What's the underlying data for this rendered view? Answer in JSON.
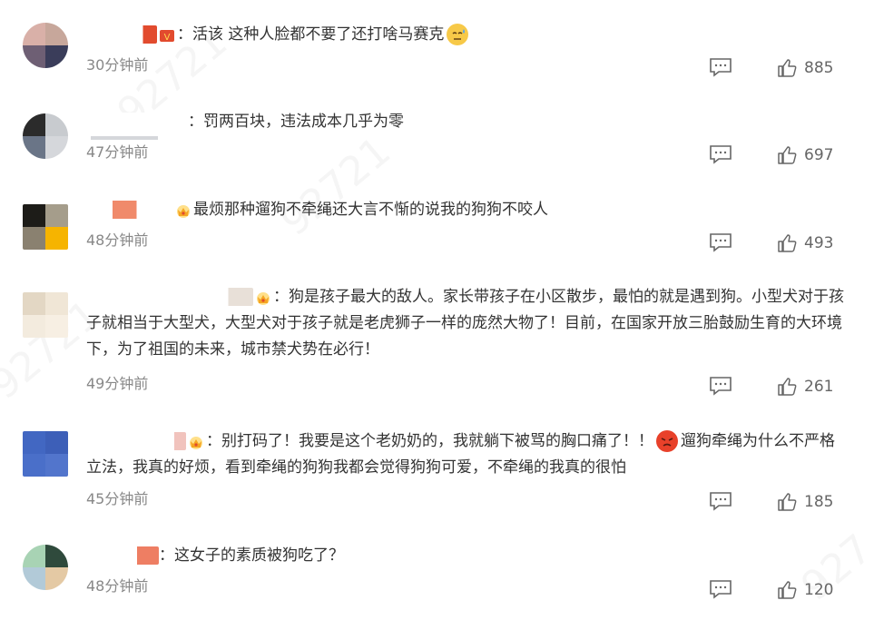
{
  "comments": [
    {
      "text": "：活该 这种人脸都不要了还打啥马赛克",
      "time": "30分钟前",
      "likes": "885",
      "avatar": [
        "#d9b0a8",
        "#c7a79b",
        "#6e5f74",
        "#3a3d5a"
      ],
      "name_color": "#e24b2e",
      "emoji": "😓"
    },
    {
      "text": "：罚两百块，违法成本几乎为零",
      "time": "47分钟前",
      "likes": "697",
      "avatar": [
        "#2b2b2b",
        "#c8cbcf",
        "#6a7587",
        "#d5d7db"
      ],
      "name_color": "#9aa0a8"
    },
    {
      "text": "最烦那种遛狗不牵绳还大言不惭的说我的狗狗不咬人",
      "time": "48分钟前",
      "likes": "493",
      "avatar": [
        "#1d1c18",
        "#a59d8b",
        "#8a8170",
        "#f6b400"
      ],
      "name_color": "#f08a6b"
    },
    {
      "text": "：狗是孩子最大的敌人。家长带孩子在小区散步，最怕的就是遇到狗。小型犬对于孩子就相当于大型犬，大型犬对于孩子就是老虎狮子一样的庞然大物了！目前，在国家开放三胎鼓励生育的大环境下，为了祖国的未来，城市禁犬势在必行！",
      "time": "49分钟前",
      "likes": "261",
      "avatar": [
        "#e3d7c4",
        "#f0e6d6",
        "#f3ebde",
        "#f7efe3"
      ],
      "name_color": "#e8e0d8"
    },
    {
      "text_a": "：别打码了！我要是这个老奶奶的，我就躺下被骂的胸口痛了！！",
      "text_b": "遛狗牵绳为什么不严格立法，我真的好烦，看到牵绳的狗狗我都会觉得狗狗可爱，不牵绳的我真的很怕",
      "time": "45分钟前",
      "likes": "185",
      "avatar": [
        "#4267c2",
        "#3d5fb8",
        "#4a6fc9",
        "#5275cc"
      ],
      "name_color": "#f1c3bd"
    },
    {
      "text": "：这女子的素质被狗吃了？",
      "time": "48分钟前",
      "likes": "120",
      "avatar": [
        "#a8d3b4",
        "#2f4a3c",
        "#b2cad8",
        "#e4c9a4"
      ],
      "name_color": "#ee7e63"
    }
  ],
  "icons": {
    "reply": "comment-bubble-icon",
    "like": "thumbs-up-icon",
    "badge": "crown-badge-icon"
  },
  "colors": {
    "text": "#333333",
    "meta": "#888888",
    "badge": "#f5a623"
  }
}
